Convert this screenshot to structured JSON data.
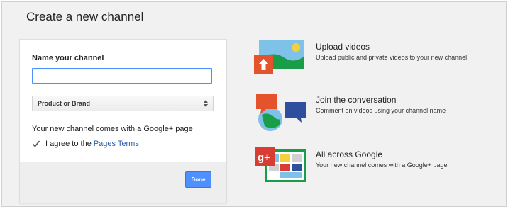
{
  "page": {
    "title": "Create a new channel"
  },
  "form": {
    "name_label": "Name your channel",
    "name_value": "",
    "name_placeholder": "",
    "channel_type_selected": "Product or Brand",
    "note": "Your new channel comes with a Google+ page",
    "agree_prefix": "I agree to the",
    "agree_link": "Pages Terms",
    "agree_checked": true,
    "done_label": "Done"
  },
  "features": [
    {
      "title": "Upload videos",
      "description": "Upload public and private videos to your new channel",
      "icon": "upload-videos-icon"
    },
    {
      "title": "Join the conversation",
      "description": "Comment on videos using your channel name",
      "icon": "conversation-icon"
    },
    {
      "title": "All across Google",
      "description": "Your new channel comes with a Google+ page",
      "icon": "google-plus-icon"
    }
  ],
  "colors": {
    "background": "#f1f1f1",
    "card": "#ffffff",
    "primary_button": "#4d90fe",
    "link": "#2a5db0",
    "google_plus_red": "#d73d32",
    "speech_orange": "#e5532d",
    "speech_blue": "#2e4f9e"
  }
}
